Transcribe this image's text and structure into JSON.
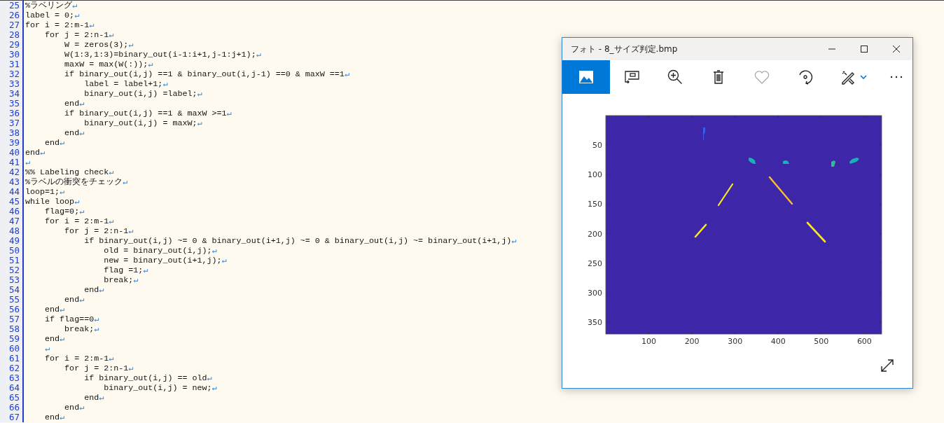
{
  "editor": {
    "lines": [
      {
        "number": "25",
        "code": "%ラベリング",
        "eol": "↵"
      },
      {
        "number": "26",
        "code": "label = 0;",
        "eol": "↵"
      },
      {
        "number": "27",
        "code": "for i = 2:m-1",
        "eol": "↵"
      },
      {
        "number": "28",
        "code": "    for j = 2:n-1",
        "eol": "↵"
      },
      {
        "number": "29",
        "code": "        W = zeros(3);",
        "eol": "↵"
      },
      {
        "number": "30",
        "code": "        W(1:3,1:3)=binary_out(i-1:i+1,j-1:j+1);",
        "eol": "↵"
      },
      {
        "number": "31",
        "code": "        maxW = max(W(:));",
        "eol": "↵"
      },
      {
        "number": "32",
        "code": "        if binary_out(i,j) ==1 & binary_out(i,j-1) ==0 & maxW ==1",
        "eol": "↵"
      },
      {
        "number": "33",
        "code": "            label = label+1;",
        "eol": "↵"
      },
      {
        "number": "34",
        "code": "            binary_out(i,j) =label;",
        "eol": "↵"
      },
      {
        "number": "35",
        "code": "        end",
        "eol": "↵"
      },
      {
        "number": "36",
        "code": "        if binary_out(i,j) ==1 & maxW >=1",
        "eol": "↵"
      },
      {
        "number": "37",
        "code": "            binary_out(i,j) = maxW;",
        "eol": "↵"
      },
      {
        "number": "38",
        "code": "        end",
        "eol": "↵"
      },
      {
        "number": "39",
        "code": "    end",
        "eol": "↵"
      },
      {
        "number": "40",
        "code": "end",
        "eol": "↵"
      },
      {
        "number": "41",
        "eol": "↵"
      },
      {
        "number": "42",
        "code": "%% Labeling check",
        "eol": "↵"
      },
      {
        "number": "43",
        "code": "%ラベルの衝突をチェック",
        "eol": "↵"
      },
      {
        "number": "44",
        "code": "loop=1;",
        "eol": "↵"
      },
      {
        "number": "45",
        "code": "while loop",
        "eol": "↵"
      },
      {
        "number": "46",
        "code": "    flag=0;",
        "eol": "↵"
      },
      {
        "number": "47",
        "code": "    for i = 2:m-1",
        "eol": "↵"
      },
      {
        "number": "48",
        "code": "        for j = 2:n-1",
        "eol": "↵"
      },
      {
        "number": "49",
        "code": "            if binary_out(i,j) ~= 0 & binary_out(i+1,j) ~= 0 & binary_out(i,j) ~= binary_out(i+1,j)",
        "eol": "↵"
      },
      {
        "number": "50",
        "code": "                old = binary_out(i,j);",
        "eol": "↵"
      },
      {
        "number": "51",
        "code": "                new = binary_out(i+1,j);",
        "eol": "↵"
      },
      {
        "number": "52",
        "code": "                flag =1;",
        "eol": "↵"
      },
      {
        "number": "53",
        "code": "                break;",
        "eol": "↵"
      },
      {
        "number": "54",
        "code": "            end",
        "eol": "↵"
      },
      {
        "number": "55",
        "code": "        end",
        "eol": "↵"
      },
      {
        "number": "56",
        "code": "    end",
        "eol": "↵"
      },
      {
        "number": "57",
        "code": "    if flag==0",
        "eol": "↵"
      },
      {
        "number": "58",
        "code": "        break;",
        "eol": "↵"
      },
      {
        "number": "59",
        "code": "    end",
        "eol": "↵"
      },
      {
        "number": "60",
        "eol": "    ↵"
      },
      {
        "number": "61",
        "code": "    for i = 2:m-1",
        "eol": "↵"
      },
      {
        "number": "62",
        "code": "        for j = 2:n-1",
        "eol": "↵"
      },
      {
        "number": "63",
        "code": "            if binary_out(i,j) == old",
        "eol": "↵"
      },
      {
        "number": "64",
        "code": "                binary_out(i,j) = new;",
        "eol": "↵"
      },
      {
        "number": "65",
        "code": "            end",
        "eol": "↵"
      },
      {
        "number": "66",
        "code": "        end",
        "eol": "↵"
      },
      {
        "number": "67",
        "code": "    end",
        "eol": "↵"
      }
    ]
  },
  "photo_window": {
    "title": "フォト - 8_サイズ判定.bmp",
    "toolbar": [
      {
        "kind": "gallery",
        "selected": true
      },
      {
        "kind": "slideshow",
        "selected": false
      },
      {
        "kind": "zoom",
        "selected": false
      },
      {
        "kind": "delete",
        "selected": false
      },
      {
        "kind": "favorite",
        "selected": false
      },
      {
        "kind": "rotate",
        "selected": false
      },
      {
        "kind": "edit",
        "selected": false
      },
      {
        "kind": "more",
        "selected": false
      }
    ],
    "plot": {
      "x_ticks": [
        "100",
        "200",
        "300",
        "400",
        "500",
        "600"
      ],
      "y_ticks": [
        "50",
        "100",
        "150",
        "200",
        "250",
        "300",
        "350"
      ]
    }
  }
}
